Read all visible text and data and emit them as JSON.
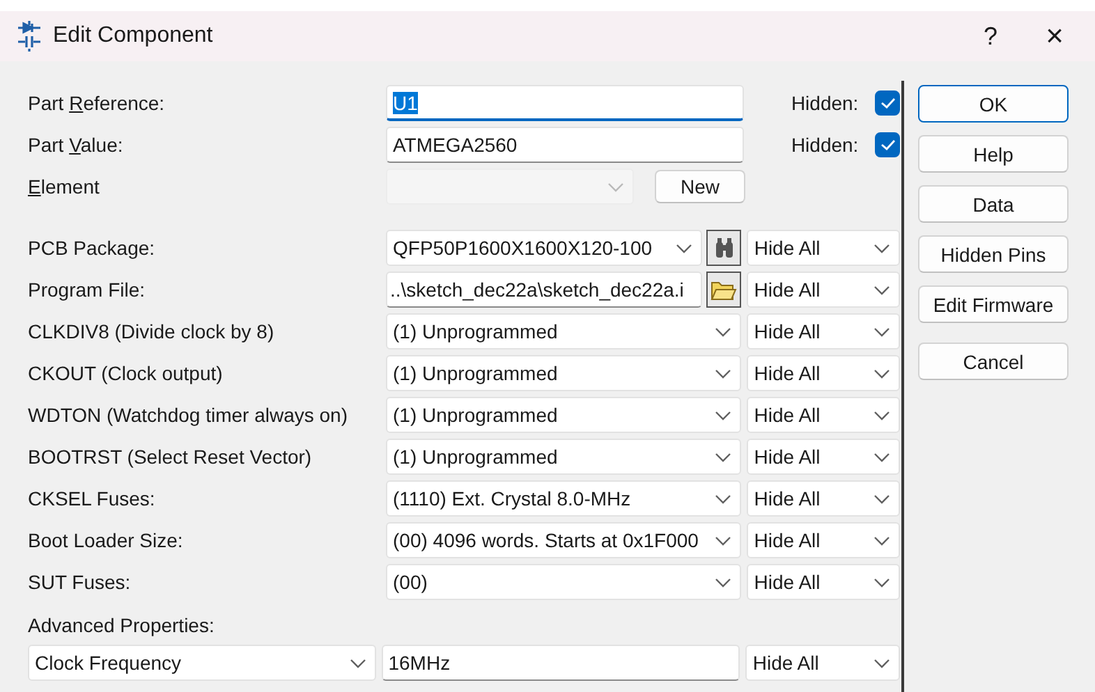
{
  "window": {
    "title": "Edit Component",
    "help_button": "?",
    "close_button": "×"
  },
  "identity": [
    {
      "label_before": "Part ",
      "access_key": "R",
      "label_after": "eference:",
      "value": "U1",
      "focused": true,
      "value_selected": true,
      "hidden_label": "Hidden:",
      "hidden": true
    },
    {
      "label_before": "Part ",
      "access_key": "V",
      "label_after": "alue:",
      "value": "ATMEGA2560",
      "focused": false,
      "value_selected": false,
      "hidden_label": "Hidden:",
      "hidden": true
    }
  ],
  "element": {
    "access_key": "E",
    "label_after": "lement",
    "disabled": true,
    "new_button": "New"
  },
  "properties": [
    {
      "label": "PCB Package:",
      "kind": "combo_search",
      "value": "QFP50P1600X1600X120-100",
      "visibility": "Hide All"
    },
    {
      "label": "Program File:",
      "kind": "text_browse",
      "value": "..\\sketch_dec22a\\sketch_dec22a.i",
      "visibility": "Hide All"
    },
    {
      "label": "CLKDIV8 (Divide clock by 8)",
      "kind": "combo",
      "value": "(1) Unprogrammed",
      "visibility": "Hide All"
    },
    {
      "label": "CKOUT (Clock output)",
      "kind": "combo",
      "value": "(1) Unprogrammed",
      "visibility": "Hide All"
    },
    {
      "label": "WDTON (Watchdog timer always on)",
      "kind": "combo",
      "value": "(1) Unprogrammed",
      "visibility": "Hide All"
    },
    {
      "label": "BOOTRST (Select Reset Vector)",
      "kind": "combo",
      "value": "(1) Unprogrammed",
      "visibility": "Hide All"
    },
    {
      "label": "CKSEL Fuses:",
      "kind": "combo",
      "value": "(1110) Ext. Crystal 8.0-MHz",
      "visibility": "Hide All"
    },
    {
      "label": "Boot Loader Size:",
      "kind": "combo",
      "value": "(00) 4096 words. Starts at 0x1F000",
      "visibility": "Hide All"
    },
    {
      "label": "SUT Fuses:",
      "kind": "combo",
      "value": "(00)",
      "visibility": "Hide All"
    }
  ],
  "advanced": {
    "heading": "Advanced Properties:",
    "property": "Clock Frequency",
    "value": "16MHz",
    "visibility": "Hide All"
  },
  "buttons": [
    {
      "label": "OK",
      "default": true
    },
    {
      "label": "Help",
      "default": false
    },
    {
      "label": "Data",
      "default": false
    },
    {
      "label": "Hidden Pins",
      "default": false
    },
    {
      "label": "Edit Firmware",
      "default": false
    }
  ],
  "cancel_button": "Cancel"
}
